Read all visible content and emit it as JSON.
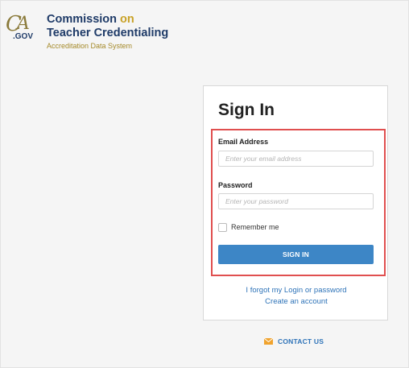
{
  "header": {
    "logo_text": "CA.GOV",
    "agency_line1": "Commission",
    "agency_on": "on",
    "agency_line2": "Teacher Credentialing",
    "subtitle": "Accreditation Data System"
  },
  "signin": {
    "title": "Sign In",
    "email_label": "Email Address",
    "email_placeholder": "Enter your email address",
    "password_label": "Password",
    "password_placeholder": "Enter your password",
    "remember_label": "Remember me",
    "button_label": "SIGN IN",
    "forgot_link": "I forgot my Login or password",
    "create_link": "Create an account"
  },
  "footer": {
    "contact_label": "CONTACT US",
    "contact_icon": "envelope-icon"
  },
  "colors": {
    "brand_navy": "#1f3b68",
    "brand_gold": "#c9a227",
    "button_blue": "#3d86c6",
    "link_blue": "#2e73b8",
    "highlight_red": "#e04f4f",
    "mail_icon_orange": "#f0a32e"
  }
}
